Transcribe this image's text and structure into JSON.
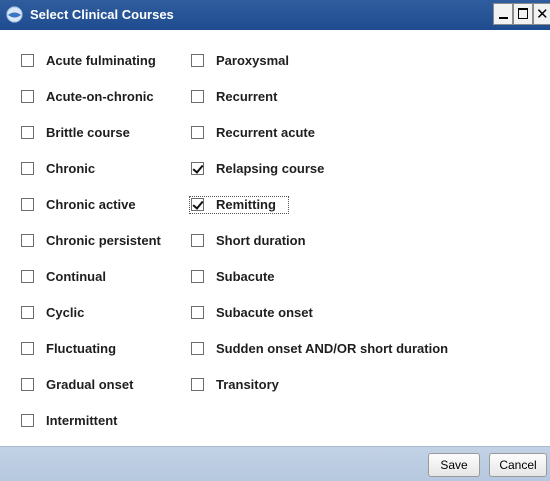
{
  "window": {
    "title": "Select Clinical Courses",
    "icon": "app-globe-icon",
    "controls": {
      "minimize": "minimize-icon",
      "maximize": "maximize-icon",
      "close": "close-icon"
    }
  },
  "columns": [
    {
      "items": [
        {
          "label": "Acute fulminating",
          "checked": false
        },
        {
          "label": "Acute-on-chronic",
          "checked": false
        },
        {
          "label": "Brittle course",
          "checked": false
        },
        {
          "label": "Chronic",
          "checked": false
        },
        {
          "label": "Chronic active",
          "checked": false
        },
        {
          "label": "Chronic persistent",
          "checked": false
        },
        {
          "label": "Continual",
          "checked": false
        },
        {
          "label": "Cyclic",
          "checked": false
        },
        {
          "label": "Fluctuating",
          "checked": false
        },
        {
          "label": "Gradual onset",
          "checked": false
        },
        {
          "label": "Intermittent",
          "checked": false
        }
      ]
    },
    {
      "items": [
        {
          "label": "Paroxysmal",
          "checked": false
        },
        {
          "label": "Recurrent",
          "checked": false
        },
        {
          "label": "Recurrent acute",
          "checked": false
        },
        {
          "label": "Relapsing course",
          "checked": true
        },
        {
          "label": "Remitting",
          "checked": true,
          "focused": true
        },
        {
          "label": "Short duration",
          "checked": false
        },
        {
          "label": "Subacute",
          "checked": false
        },
        {
          "label": "Subacute onset",
          "checked": false
        },
        {
          "label": "Sudden onset AND/OR short duration",
          "checked": false
        },
        {
          "label": "Transitory",
          "checked": false
        }
      ]
    }
  ],
  "buttons": {
    "save": "Save",
    "cancel": "Cancel"
  },
  "colors": {
    "titlebar": "#2f5d9e",
    "footer": "#c3d2e5"
  }
}
